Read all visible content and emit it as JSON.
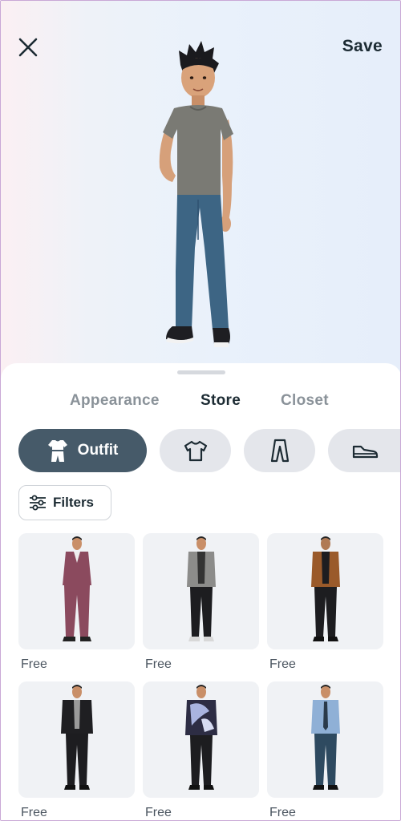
{
  "header": {
    "save_label": "Save",
    "close_icon": "close-icon"
  },
  "sheet": {
    "tabs": [
      {
        "label": "Appearance",
        "active": false
      },
      {
        "label": "Store",
        "active": true
      },
      {
        "label": "Closet",
        "active": false
      }
    ],
    "categories": [
      {
        "label": "Outfit",
        "icon": "outfit-icon",
        "active": true
      },
      {
        "label": "",
        "icon": "tshirt-icon",
        "active": false
      },
      {
        "label": "",
        "icon": "pants-icon",
        "active": false
      },
      {
        "label": "",
        "icon": "shoe-icon",
        "active": false
      }
    ],
    "filters_label": "Filters",
    "items": [
      {
        "price": "Free",
        "outfit": "maroon-suit"
      },
      {
        "price": "Free",
        "outfit": "grey-blazer"
      },
      {
        "price": "Free",
        "outfit": "brown-blazer"
      },
      {
        "price": "Free",
        "outfit": "black-jacket"
      },
      {
        "price": "Free",
        "outfit": "tie-dye-hoodie"
      },
      {
        "price": "Free",
        "outfit": "blue-shirt-tie"
      }
    ]
  },
  "colors": {
    "accent": "#465a69",
    "chip_bg": "#e4e6eb",
    "tile_bg": "#f0f2f5",
    "text_primary": "#1c2b33",
    "text_muted": "#8a9299"
  }
}
